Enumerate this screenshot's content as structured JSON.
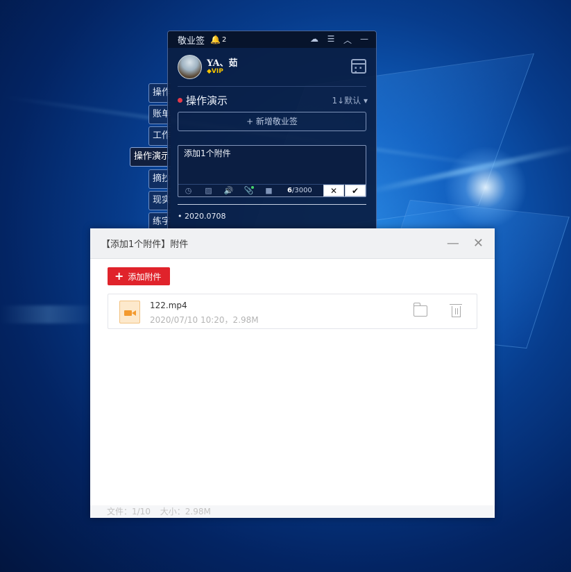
{
  "note_app": {
    "title": "敬业签",
    "notification_count": "2",
    "titlebar_icons": [
      "cloud-sync-icon",
      "menu-icon",
      "collapse-icon",
      "minimize-icon"
    ],
    "user": {
      "name": "YA、茹",
      "badge": "VIP"
    },
    "category": {
      "name": "操作演示",
      "sort_label": "1↓默认"
    },
    "new_note_label": "+ 新增敬业签",
    "editor": {
      "text": "添加1个附件",
      "count": "6",
      "limit": "/3000",
      "cancel_symbol": "✕",
      "confirm_symbol": "✔"
    },
    "notes": [
      {
        "date": "2020.0708"
      }
    ],
    "side_tabs": [
      "操作",
      "账单",
      "工作",
      "操作演示",
      "摘抄",
      "现实",
      "练字"
    ],
    "active_tab_index": 3
  },
  "dialog": {
    "title": "【添加1个附件】附件",
    "add_button_label": "添加附件",
    "files": [
      {
        "name": "122.mp4",
        "meta": "2020/07/10 10:20，2.98M"
      }
    ],
    "status": {
      "files": "文件：1/10",
      "size": "大小：2.98M"
    }
  },
  "colors": {
    "accent_red": "#e0232b",
    "note_bg": "#0a1e44",
    "category_dot": "#e33a4a"
  }
}
